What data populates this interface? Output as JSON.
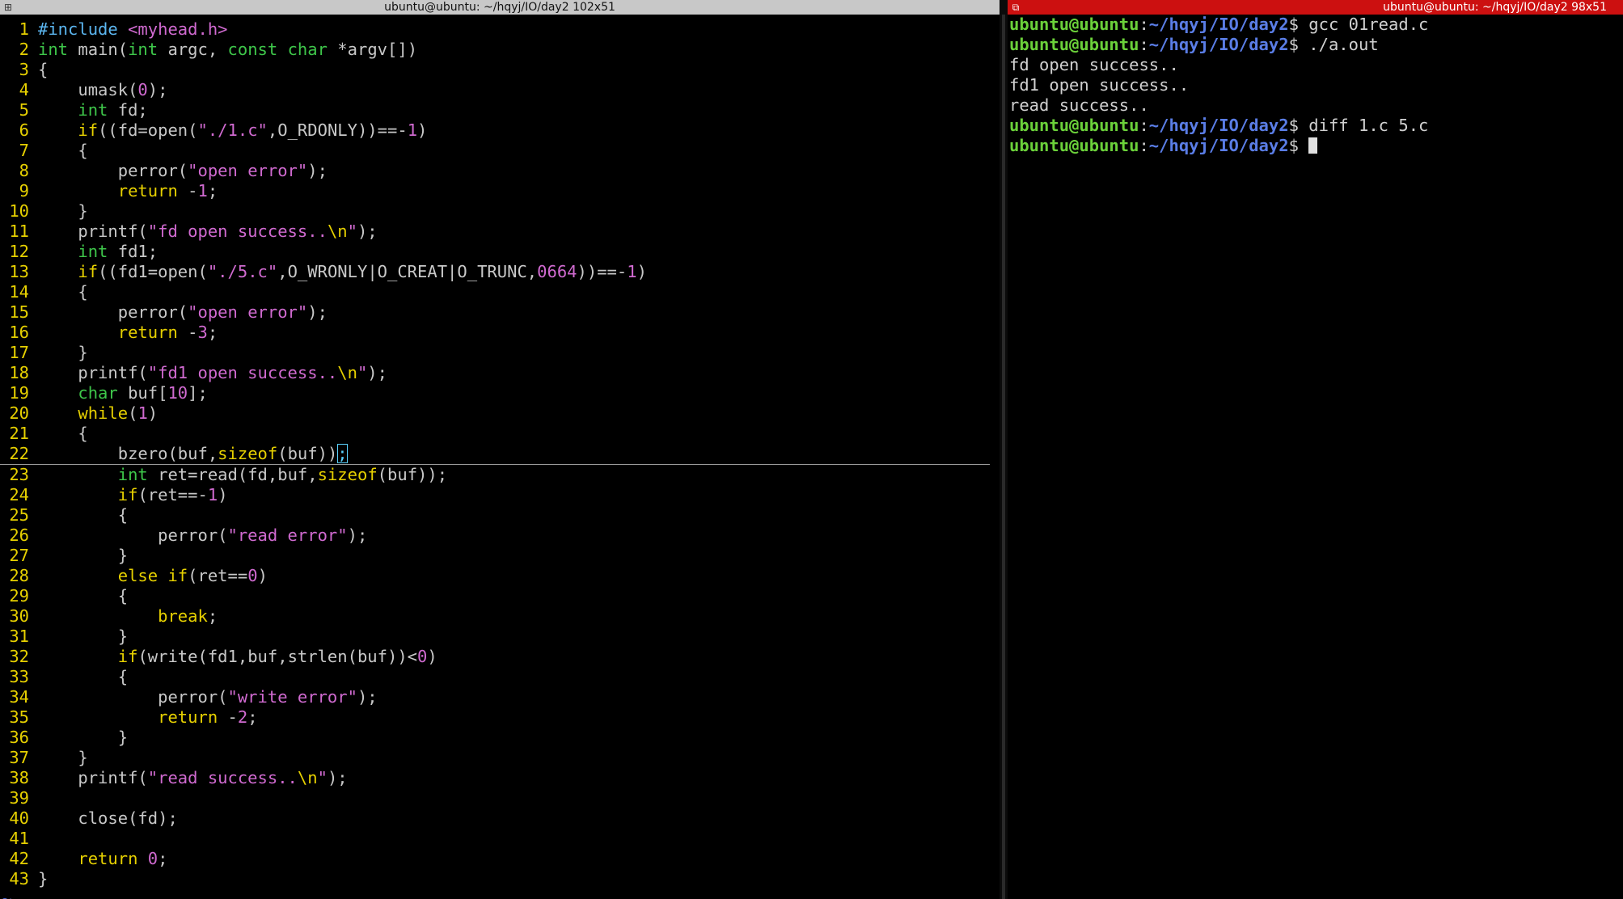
{
  "left_terminal": {
    "title": "ubuntu@ubuntu: ~/hqyj/IO/day2 102x51",
    "current_line": 22,
    "tilde": "~",
    "lines": [
      {
        "n": "1",
        "tokens": [
          [
            "pp",
            "#include "
          ],
          [
            "str",
            "<myhead.h>"
          ]
        ]
      },
      {
        "n": "2",
        "tokens": [
          [
            "ty",
            "int"
          ],
          [
            "",
            " main("
          ],
          [
            "ty",
            "int"
          ],
          [
            "",
            " argc, "
          ],
          [
            "ty",
            "const"
          ],
          [
            "",
            " "
          ],
          [
            "ty",
            "char"
          ],
          [
            "",
            " *argv[])"
          ]
        ]
      },
      {
        "n": "3",
        "tokens": [
          [
            "",
            "{"
          ]
        ]
      },
      {
        "n": "4",
        "tokens": [
          [
            "",
            "    umask("
          ],
          [
            "num",
            "0"
          ],
          [
            "",
            ");"
          ]
        ]
      },
      {
        "n": "5",
        "tokens": [
          [
            "",
            "    "
          ],
          [
            "ty",
            "int"
          ],
          [
            "",
            " fd;"
          ]
        ]
      },
      {
        "n": "6",
        "tokens": [
          [
            "",
            "    "
          ],
          [
            "kw",
            "if"
          ],
          [
            "",
            "((fd=open("
          ],
          [
            "str",
            "\"./1.c\""
          ],
          [
            "",
            ",O_RDONLY))==-"
          ],
          [
            "num",
            "1"
          ],
          [
            "",
            ")"
          ]
        ]
      },
      {
        "n": "7",
        "tokens": [
          [
            "",
            "    {"
          ]
        ]
      },
      {
        "n": "8",
        "tokens": [
          [
            "",
            "        perror("
          ],
          [
            "str",
            "\"open error\""
          ],
          [
            "",
            ");"
          ]
        ]
      },
      {
        "n": "9",
        "tokens": [
          [
            "",
            "        "
          ],
          [
            "kw",
            "return"
          ],
          [
            "",
            " -"
          ],
          [
            "num",
            "1"
          ],
          [
            "",
            ";"
          ]
        ]
      },
      {
        "n": "10",
        "tokens": [
          [
            "",
            "    }"
          ]
        ]
      },
      {
        "n": "11",
        "tokens": [
          [
            "",
            "    printf("
          ],
          [
            "str",
            "\"fd open success.."
          ],
          [
            "sp",
            "\\n"
          ],
          [
            "str",
            "\""
          ],
          [
            "",
            ");"
          ]
        ]
      },
      {
        "n": "12",
        "tokens": [
          [
            "",
            "    "
          ],
          [
            "ty",
            "int"
          ],
          [
            "",
            " fd1;"
          ]
        ]
      },
      {
        "n": "13",
        "tokens": [
          [
            "",
            "    "
          ],
          [
            "kw",
            "if"
          ],
          [
            "",
            "((fd1=open("
          ],
          [
            "str",
            "\"./5.c\""
          ],
          [
            "",
            ",O_WRONLY|O_CREAT|O_TRUNC,"
          ],
          [
            "num",
            "0664"
          ],
          [
            "",
            "))==-"
          ],
          [
            "num",
            "1"
          ],
          [
            "",
            ")"
          ]
        ]
      },
      {
        "n": "14",
        "tokens": [
          [
            "",
            "    {"
          ]
        ]
      },
      {
        "n": "15",
        "tokens": [
          [
            "",
            "        perror("
          ],
          [
            "str",
            "\"open error\""
          ],
          [
            "",
            ");"
          ]
        ]
      },
      {
        "n": "16",
        "tokens": [
          [
            "",
            "        "
          ],
          [
            "kw",
            "return"
          ],
          [
            "",
            " -"
          ],
          [
            "num",
            "3"
          ],
          [
            "",
            ";"
          ]
        ]
      },
      {
        "n": "17",
        "tokens": [
          [
            "",
            "    }"
          ]
        ]
      },
      {
        "n": "18",
        "tokens": [
          [
            "",
            "    printf("
          ],
          [
            "str",
            "\"fd1 open success.."
          ],
          [
            "sp",
            "\\n"
          ],
          [
            "str",
            "\""
          ],
          [
            "",
            ");"
          ]
        ]
      },
      {
        "n": "19",
        "tokens": [
          [
            "",
            "    "
          ],
          [
            "ty",
            "char"
          ],
          [
            "",
            " buf["
          ],
          [
            "num",
            "10"
          ],
          [
            "",
            "];"
          ]
        ]
      },
      {
        "n": "20",
        "tokens": [
          [
            "",
            "    "
          ],
          [
            "kw",
            "while"
          ],
          [
            "",
            "("
          ],
          [
            "num",
            "1"
          ],
          [
            "",
            ")"
          ]
        ]
      },
      {
        "n": "21",
        "tokens": [
          [
            "",
            "    {"
          ]
        ]
      },
      {
        "n": "22",
        "tokens": [
          [
            "",
            "        bzero(buf,"
          ],
          [
            "kw",
            "sizeof"
          ],
          [
            "",
            "(buf))"
          ],
          [
            "mb",
            ";"
          ]
        ]
      },
      {
        "n": "23",
        "tokens": [
          [
            "",
            "        "
          ],
          [
            "ty",
            "int"
          ],
          [
            "",
            " ret=read(fd,buf,"
          ],
          [
            "kw",
            "sizeof"
          ],
          [
            "",
            "(buf));"
          ]
        ]
      },
      {
        "n": "24",
        "tokens": [
          [
            "",
            "        "
          ],
          [
            "kw",
            "if"
          ],
          [
            "",
            "(ret==-"
          ],
          [
            "num",
            "1"
          ],
          [
            "",
            ")"
          ]
        ]
      },
      {
        "n": "25",
        "tokens": [
          [
            "",
            "        {"
          ]
        ]
      },
      {
        "n": "26",
        "tokens": [
          [
            "",
            "            perror("
          ],
          [
            "str",
            "\"read error\""
          ],
          [
            "",
            ");"
          ]
        ]
      },
      {
        "n": "27",
        "tokens": [
          [
            "",
            "        }"
          ]
        ]
      },
      {
        "n": "28",
        "tokens": [
          [
            "",
            "        "
          ],
          [
            "kw",
            "else"
          ],
          [
            "",
            " "
          ],
          [
            "kw",
            "if"
          ],
          [
            "",
            "(ret=="
          ],
          [
            "num",
            "0"
          ],
          [
            "",
            ")"
          ]
        ]
      },
      {
        "n": "29",
        "tokens": [
          [
            "",
            "        {"
          ]
        ]
      },
      {
        "n": "30",
        "tokens": [
          [
            "",
            "            "
          ],
          [
            "kw",
            "break"
          ],
          [
            "",
            ";"
          ]
        ]
      },
      {
        "n": "31",
        "tokens": [
          [
            "",
            "        }"
          ]
        ]
      },
      {
        "n": "32",
        "tokens": [
          [
            "",
            "        "
          ],
          [
            "kw",
            "if"
          ],
          [
            "",
            "(write(fd1,buf,strlen(buf))<"
          ],
          [
            "num",
            "0"
          ],
          [
            "",
            ")"
          ]
        ]
      },
      {
        "n": "33",
        "tokens": [
          [
            "",
            "        {"
          ]
        ]
      },
      {
        "n": "34",
        "tokens": [
          [
            "",
            "            perror("
          ],
          [
            "str",
            "\"write error\""
          ],
          [
            "",
            ");"
          ]
        ]
      },
      {
        "n": "35",
        "tokens": [
          [
            "",
            "            "
          ],
          [
            "kw",
            "return"
          ],
          [
            "",
            " -"
          ],
          [
            "num",
            "2"
          ],
          [
            "",
            ";"
          ]
        ]
      },
      {
        "n": "36",
        "tokens": [
          [
            "",
            "        }"
          ]
        ]
      },
      {
        "n": "37",
        "tokens": [
          [
            "",
            "    }"
          ]
        ]
      },
      {
        "n": "38",
        "tokens": [
          [
            "",
            "    printf("
          ],
          [
            "str",
            "\"read success.."
          ],
          [
            "sp",
            "\\n"
          ],
          [
            "str",
            "\""
          ],
          [
            "",
            ");"
          ]
        ]
      },
      {
        "n": "39",
        "tokens": []
      },
      {
        "n": "40",
        "tokens": [
          [
            "",
            "    close(fd);"
          ]
        ]
      },
      {
        "n": "41",
        "tokens": []
      },
      {
        "n": "42",
        "tokens": [
          [
            "",
            "    "
          ],
          [
            "kw",
            "return"
          ],
          [
            "",
            " "
          ],
          [
            "num",
            "0"
          ],
          [
            "",
            ";"
          ]
        ]
      },
      {
        "n": "43",
        "tokens": [
          [
            "",
            "}"
          ]
        ]
      }
    ]
  },
  "right_terminal": {
    "title": "ubuntu@ubuntu: ~/hqyj/IO/day2 98x51",
    "lines": [
      {
        "prompt_user": "ubuntu@ubuntu",
        "prompt_sep": ":",
        "prompt_path": "~/hqyj/IO/day2",
        "prompt_end": "$ ",
        "command": "gcc 01read.c"
      },
      {
        "prompt_user": "ubuntu@ubuntu",
        "prompt_sep": ":",
        "prompt_path": "~/hqyj/IO/day2",
        "prompt_end": "$ ",
        "command": "./a.out"
      },
      {
        "output": "fd open success.."
      },
      {
        "output": "fd1 open success.."
      },
      {
        "output": "read success.."
      },
      {
        "prompt_user": "ubuntu@ubuntu",
        "prompt_sep": ":",
        "prompt_path": "~/hqyj/IO/day2",
        "prompt_end": "$ ",
        "command": "diff 1.c 5.c"
      },
      {
        "prompt_user": "ubuntu@ubuntu",
        "prompt_sep": ":",
        "prompt_path": "~/hqyj/IO/day2",
        "prompt_end": "$ ",
        "command": "",
        "cursor": true
      }
    ]
  },
  "icons": {
    "left_titlebar": "terminal-window-icon",
    "right_titlebar": "terminal-window-icon"
  }
}
